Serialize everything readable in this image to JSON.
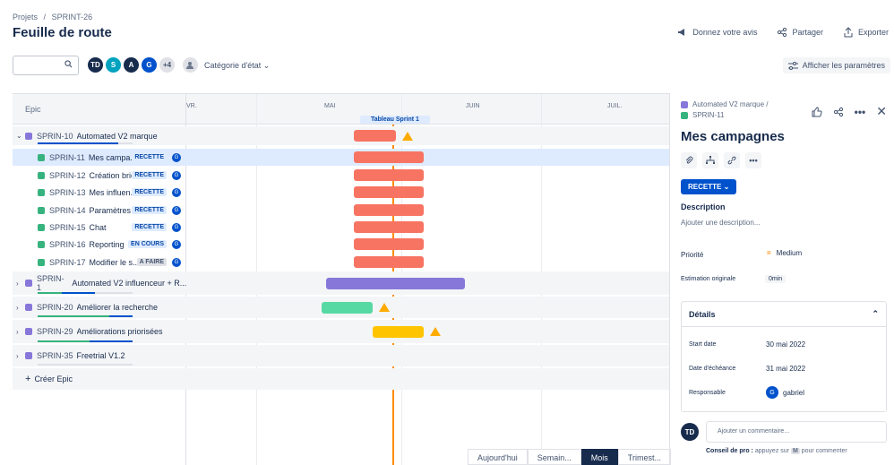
{
  "breadcrumb": {
    "root": "Projets",
    "sep": "/",
    "project": "SPRINT-26"
  },
  "title": "Feuille de route",
  "top_actions": {
    "feedback": "Donnez votre avis",
    "share": "Partager",
    "export": "Exporter"
  },
  "search": {
    "placeholder": ""
  },
  "avatars": [
    {
      "initials": "TD",
      "color": "#172b4d"
    },
    {
      "initials": "S",
      "color": "#00a3bf"
    },
    {
      "initials": "A",
      "color": "#172b4d"
    },
    {
      "initials": "G",
      "color": "#0052cc"
    },
    {
      "initials": "+4",
      "color": "#dfe1e6"
    }
  ],
  "filter": {
    "status_category": "Catégorie d'état"
  },
  "show_params": "Afficher les paramètres",
  "board": {
    "column_epic": "Epic",
    "months": [
      "VR.",
      "MAI",
      "JUIN",
      "JUIL."
    ],
    "sprint_label": "Tableau Sprint 1",
    "create_epic": "Créer Epic",
    "rows": [
      {
        "kind": "epic",
        "key": "SPRIN-10",
        "summary": "Automated V2 marque",
        "expanded": true,
        "progress_done": 0,
        "progress_inprog": 0.85,
        "bar_color": "#f87462",
        "warning": true
      },
      {
        "kind": "story",
        "key": "SPRIN-11",
        "summary": "Mes campa...",
        "status": "RECETTE",
        "assignee": "G",
        "selected": true,
        "bar_color": "#f87462"
      },
      {
        "kind": "story",
        "key": "SPRIN-12",
        "summary": "Création brief",
        "status": "RECETTE",
        "assignee": "G",
        "bar_color": "#f87462"
      },
      {
        "kind": "story",
        "key": "SPRIN-13",
        "summary": "Mes influen...",
        "status": "RECETTE",
        "assignee": "G",
        "bar_color": "#f87462"
      },
      {
        "kind": "story",
        "key": "SPRIN-14",
        "summary": "Paramètres",
        "status": "RECETTE",
        "assignee": "G",
        "bar_color": "#f87462"
      },
      {
        "kind": "story",
        "key": "SPRIN-15",
        "summary": "Chat",
        "status": "RECETTE",
        "assignee": "G",
        "bar_color": "#f87462"
      },
      {
        "kind": "story",
        "key": "SPRIN-16",
        "summary": "Reporting",
        "status": "EN COURS",
        "assignee": "G",
        "bar_color": "#f87462"
      },
      {
        "kind": "story",
        "key": "SPRIN-17",
        "summary": "Modifier le s...",
        "status": "A FAIRE",
        "assignee": "G",
        "bar_color": "#f87462"
      },
      {
        "kind": "epic",
        "key": "SPRIN-1",
        "summary": "Automated V2 influenceur + R...",
        "expanded": false,
        "progress_done": 0.25,
        "progress_inprog": 0.35,
        "bar_color": "#8777d9",
        "warning": false
      },
      {
        "kind": "epic",
        "key": "SPRIN-20",
        "summary": "Améliorer la recherche",
        "expanded": false,
        "progress_done": 0.75,
        "progress_inprog": 0.25,
        "bar_color": "#57d9a3",
        "warning": true
      },
      {
        "kind": "epic",
        "key": "SPRIN-29",
        "summary": "Améliorations priorisées",
        "expanded": false,
        "progress_done": 0.55,
        "progress_inprog": 0.45,
        "bar_color": "#ffc400",
        "warning": true
      },
      {
        "kind": "epic",
        "key": "SPRIN-35",
        "summary": "Freetrial V1.2",
        "expanded": false,
        "progress_done": 0,
        "progress_inprog": 0,
        "bar_color": "",
        "warning": false
      }
    ]
  },
  "zoom": {
    "today": "Aujourd'hui",
    "week": "Semain...",
    "month": "Mois",
    "quarter": "Trimest..."
  },
  "panel": {
    "parent_key": "Automated V2 marque",
    "parent_sep": "/",
    "issue_key": "SPRIN-11",
    "title": "Mes campagnes",
    "status": "RECETTE",
    "description_label": "Description",
    "description_placeholder": "Ajouter une description...",
    "priority_label": "Priorité",
    "priority_value": "Medium",
    "estimate_label": "Estimation originale",
    "estimate_value": "0min",
    "details_label": "Détails",
    "start_label": "Start date",
    "start_value": "30 mai 2022",
    "due_label": "Date d'échéance",
    "due_value": "31 mai 2022",
    "assignee_label": "Responsable",
    "assignee_value": "gabriel",
    "assignee_initial": "G",
    "comment_avatar": "TD",
    "comment_placeholder": "Ajouter un commentaire...",
    "pro_tip_label": "Conseil de pro :",
    "pro_tip_text1": "appuyez sur",
    "pro_tip_key": "M",
    "pro_tip_text2": "pour commenter"
  }
}
